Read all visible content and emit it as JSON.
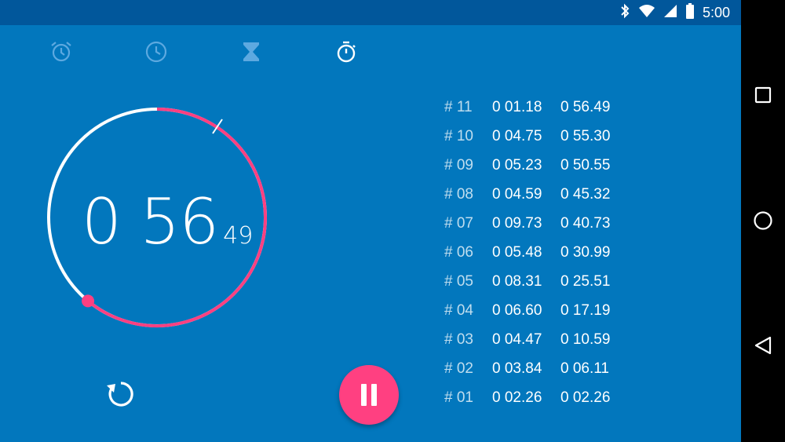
{
  "status_bar": {
    "time": "5:00"
  },
  "tabs": [
    {
      "name": "alarm",
      "icon": "alarm-icon",
      "active": false
    },
    {
      "name": "clock",
      "icon": "clock-icon",
      "active": false
    },
    {
      "name": "timer",
      "icon": "hourglass-icon",
      "active": false
    },
    {
      "name": "stopwatch",
      "icon": "stopwatch-icon",
      "active": true
    }
  ],
  "stopwatch": {
    "main": "0 56",
    "hundredths": "49",
    "progress_fraction": 0.61
  },
  "laps": [
    {
      "num": "# 11",
      "lap": "0 01.18",
      "total": "0 56.49"
    },
    {
      "num": "# 10",
      "lap": "0 04.75",
      "total": "0 55.30"
    },
    {
      "num": "# 09",
      "lap": "0 05.23",
      "total": "0 50.55"
    },
    {
      "num": "# 08",
      "lap": "0 04.59",
      "total": "0 45.32"
    },
    {
      "num": "# 07",
      "lap": "0 09.73",
      "total": "0 40.73"
    },
    {
      "num": "# 06",
      "lap": "0 05.48",
      "total": "0 30.99"
    },
    {
      "num": "# 05",
      "lap": "0 08.31",
      "total": "0 25.51"
    },
    {
      "num": "# 04",
      "lap": "0 06.60",
      "total": "0 17.19"
    },
    {
      "num": "# 03",
      "lap": "0 04.47",
      "total": "0 10.59"
    },
    {
      "num": "# 02",
      "lap": "0 03.84",
      "total": "0 06.11"
    },
    {
      "num": "# 01",
      "lap": "0 02.26",
      "total": "0 02.26"
    }
  ],
  "colors": {
    "background": "#0277BD",
    "status_bar": "#01579B",
    "accent": "#FF4081"
  }
}
